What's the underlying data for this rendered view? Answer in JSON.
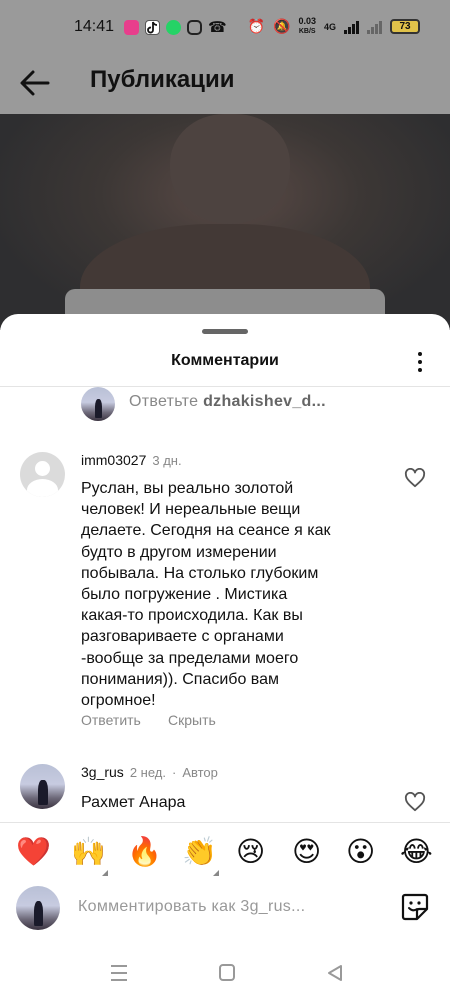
{
  "status_bar": {
    "time": "14:41",
    "net_speed_value": "0.03",
    "net_speed_unit": "KB/S",
    "signal_label": "4G",
    "battery": "73",
    "icons": [
      "instagram-lite-icon",
      "tiktok-icon",
      "whatsapp-icon",
      "instagram-icon",
      "call-icon",
      "alarm-icon",
      "mute-icon"
    ]
  },
  "header": {
    "title": "Публикации"
  },
  "comments_sheet": {
    "title": "Комментарии",
    "reply_to": {
      "prefix": "Ответьте",
      "user": "dzhakishev_d..."
    },
    "comments": [
      {
        "username": "imm03027",
        "time": "3 дн.",
        "badge": "",
        "lines": [
          "Руслан, вы реально золотой",
          "человек!  И нереальные вещи",
          "делаете. Сегодня на сеансе я как",
          "будто в другом измерении",
          "побывала. На столько глубоким",
          "было  погружение . Мистика",
          "какая-то происходила.  Как вы",
          "разговариваете с органами",
          "-вообще за пределами моего",
          "понимания)). Спасибо вам",
          "огромное!"
        ],
        "reply_label": "Ответить",
        "hide_label": "Скрыть"
      },
      {
        "username": "3g_rus",
        "time": "2 нед.",
        "badge": "Автор",
        "text": "Рахмет Анара"
      }
    ]
  },
  "emoji_bar": [
    "❤️",
    "🙌",
    "🔥",
    "👏",
    "😢",
    "😍",
    "😮",
    "😂"
  ],
  "composer": {
    "placeholder": "Комментировать как 3g_rus..."
  }
}
